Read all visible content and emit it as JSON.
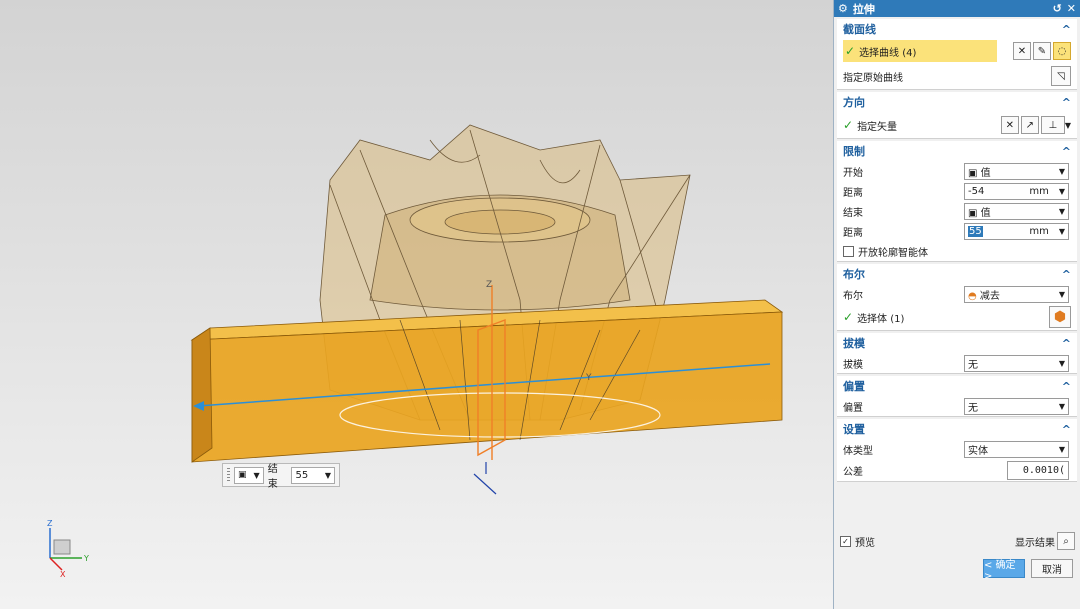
{
  "dialog": {
    "title": "拉伸",
    "sections": {
      "section_curve": {
        "title": "截面线",
        "select_curve_label": "选择曲线 (4)",
        "specify_origin_label": "指定原始曲线"
      },
      "direction": {
        "title": "方向",
        "specify_vector_label": "指定矢量"
      },
      "limits": {
        "title": "限制",
        "start_label": "开始",
        "start_value": "值",
        "distance_label": "距离",
        "start_distance": "-54",
        "end_label": "结束",
        "end_value": "值",
        "end_distance": "55",
        "unit": "mm",
        "open_profile_label": "开放轮廓智能体"
      },
      "boolean": {
        "title": "布尔",
        "boolean_label": "布尔",
        "boolean_value": "减去",
        "select_body_label": "选择体 (1)"
      },
      "draft": {
        "title": "拔模",
        "draft_label": "拔模",
        "draft_value": "无"
      },
      "offset": {
        "title": "偏置",
        "offset_label": "偏置",
        "offset_value": "无"
      },
      "settings": {
        "title": "设置",
        "body_type_label": "体类型",
        "body_type_value": "实体",
        "tolerance_label": "公差",
        "tolerance_value": "0.0010("
      }
    },
    "preview_label": "预览",
    "show_result_label": "显示结果",
    "ok_label": "< 确定 >",
    "cancel_label": "取消"
  },
  "viewport": {
    "minibar": {
      "end_label": "结束",
      "end_value": "55"
    },
    "triad": {
      "x": "X",
      "y": "Y",
      "z": "Z"
    },
    "axis_labels": {
      "y": "Y",
      "z": "Z"
    }
  },
  "colors": {
    "accent": "#2f7ab9",
    "highlight": "#fbe27a",
    "block": "#e9a420"
  }
}
